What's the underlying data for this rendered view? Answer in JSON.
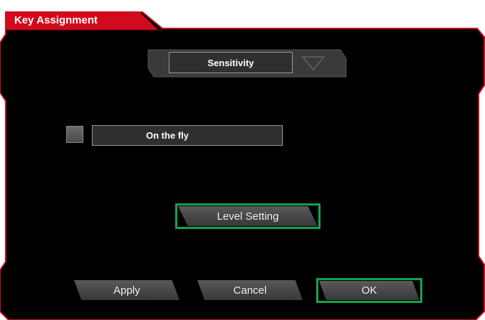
{
  "window": {
    "title": "Key Assignment"
  },
  "sensitivity_select": {
    "value": "Sensitivity"
  },
  "on_the_fly": {
    "checked": false,
    "value": "On the fly"
  },
  "buttons": {
    "level_setting": "Level Setting",
    "apply": "Apply",
    "cancel": "Cancel",
    "ok": "OK"
  },
  "colors": {
    "accent_red": "#d20a1e",
    "panel_bg": "#000000",
    "highlight_green": "#16a34a"
  }
}
